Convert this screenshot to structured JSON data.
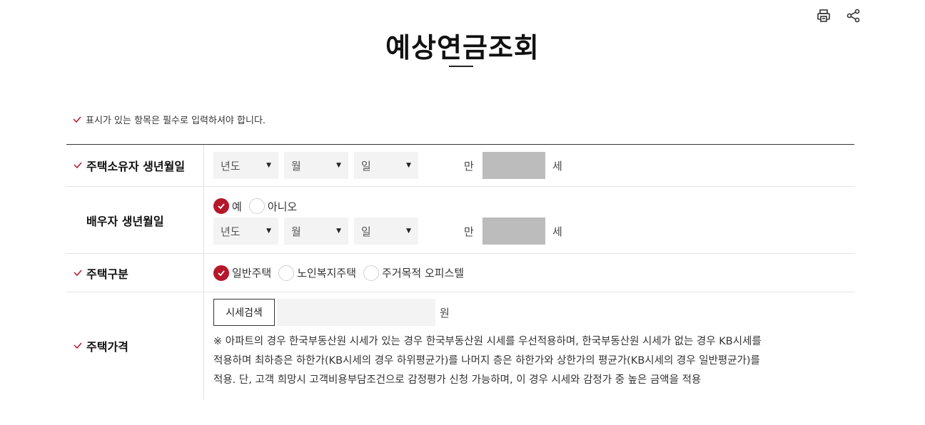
{
  "page": {
    "title": "예상연금조회",
    "notice": "표시가 있는 항목은 필수로 입력하셔야 합니다."
  },
  "toolbar": {
    "print_icon": "print-icon",
    "share_icon": "share-icon"
  },
  "colors": {
    "accent": "#b5172a",
    "age_box": "#bcbcbc",
    "field_bg": "#f3f3f3"
  },
  "form": {
    "owner_birth": {
      "label": "주택소유자 생년월일",
      "required": true,
      "year": "년도",
      "month": "월",
      "day": "일",
      "age_prefix": "만",
      "age_suffix": "세"
    },
    "spouse_birth": {
      "label": "배우자 생년월일",
      "required": false,
      "options": [
        {
          "label": "예",
          "checked": true
        },
        {
          "label": "아니오",
          "checked": false
        }
      ],
      "year": "년도",
      "month": "월",
      "day": "일",
      "age_prefix": "만",
      "age_suffix": "세"
    },
    "house_type": {
      "label": "주택구분",
      "required": true,
      "options": [
        {
          "label": "일반주택",
          "checked": true
        },
        {
          "label": "노인복지주택",
          "checked": false
        },
        {
          "label": "주거목적 오피스텔",
          "checked": false
        }
      ]
    },
    "house_price": {
      "label": "주택가격",
      "required": true,
      "search_button": "시세검색",
      "price_value": "",
      "unit": "원",
      "note_lines": [
        "※ 아파트의 경우 한국부동산원 시세가 있는 경우 한국부동산원 시세를 우선적용하며, 한국부동산원 시세가 없는 경우 KB시세를",
        "적용하며 최하층은 하한가(KB시세의 경우 하위평균가)를 나머지 층은 하한가와 상한가의 평균가(KB시세의 경우 일반평균가)를",
        "적용. 단, 고객 희망시 고객비용부담조건으로 감정평가 신청 가능하며, 이 경우 시세와 감정가 중 높은 금액을 적용"
      ]
    }
  }
}
